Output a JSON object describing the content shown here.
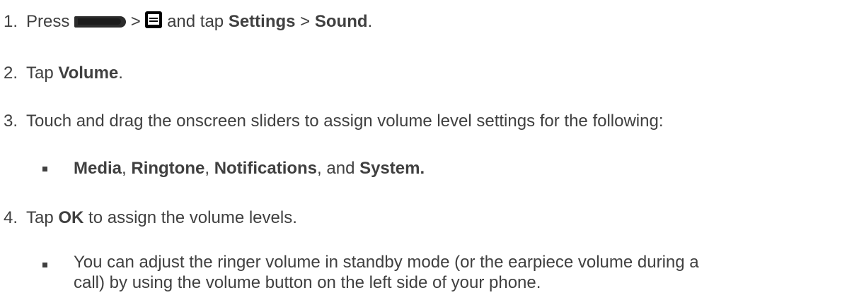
{
  "steps": [
    {
      "number": "1.",
      "press": "Press",
      "gt1": ">",
      "and_tap": "and tap",
      "settings": "Settings",
      "gt2": ">",
      "sound": "Sound",
      "period": ".",
      "icons": [
        "home-key-icon",
        "menu-icon"
      ]
    },
    {
      "number": "2.",
      "tap": "Tap",
      "volume": "Volume",
      "period": "."
    },
    {
      "number": "3.",
      "text": "Touch and drag the onscreen sliders to assign volume level settings for the following:",
      "bullet": {
        "media": "Media",
        "comma1": ", ",
        "ringtone": "Ringtone",
        "comma2": ", ",
        "notifications": "Notifications",
        "and": ", and ",
        "system": "System."
      }
    },
    {
      "number": "4.",
      "tap": "Tap",
      "ok": "OK",
      "rest": "to assign the volume levels.",
      "bullet": {
        "line1": "You can adjust the ringer volume in standby mode (or the earpiece volume during a",
        "line2": "call) by using the volume button on the left side of your phone."
      }
    }
  ]
}
